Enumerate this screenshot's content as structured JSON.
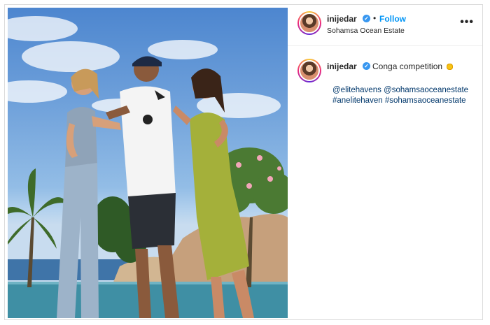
{
  "post": {
    "username": "inijedar",
    "verified_icon": "verified-badge-icon",
    "separator": "•",
    "follow_label": "Follow",
    "location": "Sohamsa Ocean Estate",
    "more_icon": "more-options-icon",
    "more_label": "•••"
  },
  "caption": {
    "username": "inijedar",
    "text": "Conga competition",
    "emoji_icon": "sun-emoji-icon",
    "mentions": [
      "@elitehavens",
      "@sohamsaoceanestate"
    ],
    "hashtags": [
      "#anelitehaven",
      "#sohamsaoceanestate"
    ]
  },
  "colors": {
    "follow": "#0095f6",
    "verified": "#3897f0",
    "link": "#00376b"
  }
}
